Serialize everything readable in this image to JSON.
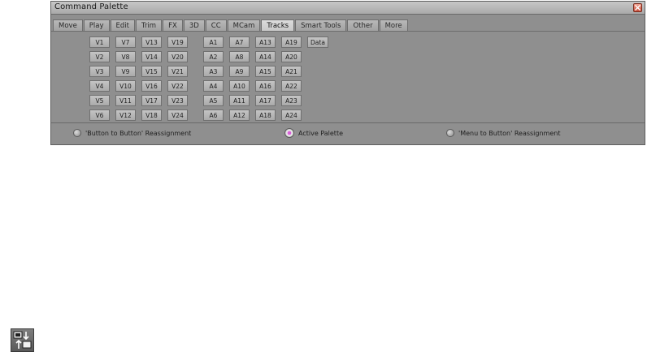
{
  "window": {
    "title": "Command Palette"
  },
  "tabs": [
    "Move",
    "Play",
    "Edit",
    "Trim",
    "FX",
    "3D",
    "CC",
    "MCam",
    "Tracks",
    "Smart Tools",
    "Other",
    "More"
  ],
  "active_tab": "Tracks",
  "video_tracks": [
    [
      "V1",
      "V7",
      "V13",
      "V19"
    ],
    [
      "V2",
      "V8",
      "V14",
      "V20"
    ],
    [
      "V3",
      "V9",
      "V15",
      "V21"
    ],
    [
      "V4",
      "V10",
      "V16",
      "V22"
    ],
    [
      "V5",
      "V11",
      "V17",
      "V23"
    ],
    [
      "V6",
      "V12",
      "V18",
      "V24"
    ]
  ],
  "audio_tracks": [
    [
      "A1",
      "A7",
      "A13",
      "A19"
    ],
    [
      "A2",
      "A8",
      "A14",
      "A20"
    ],
    [
      "A3",
      "A9",
      "A15",
      "A21"
    ],
    [
      "A4",
      "A10",
      "A16",
      "A22"
    ],
    [
      "A5",
      "A11",
      "A17",
      "A23"
    ],
    [
      "A6",
      "A12",
      "A18",
      "A24"
    ]
  ],
  "data_button": "Data",
  "modes": [
    {
      "label": "'Button to Button' Reassignment",
      "selected": false
    },
    {
      "label": "Active Palette",
      "selected": true
    },
    {
      "label": "'Menu to Button' Reassignment",
      "selected": false
    }
  ],
  "colors": {
    "window_bg": "#8f8f8f",
    "active_radio": "#d860d8",
    "close_button": "#c8503c"
  },
  "icons": {
    "close": "close-icon",
    "corner": "palette-reassign-icon"
  }
}
